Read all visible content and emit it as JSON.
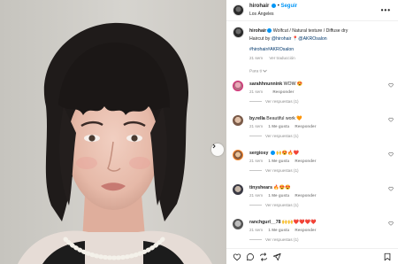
{
  "post": {
    "username": "hirohair",
    "separator": "•",
    "follow_label": "Seguir",
    "location": "Los Ángeles",
    "more_label": "•••"
  },
  "caption": {
    "username": "hirohair",
    "text_line1": " Wolfcut / Natural texture / Diffuse dry",
    "text_line2_prefix": "Haircut by ",
    "mention1": "@hirohair",
    "mention2": "@AKROsalon",
    "hashtags": "#hirohair#AKROsalon",
    "time": "21 sem",
    "translate_label": "Ver traducción"
  },
  "for_you_label": "Para ti",
  "comments": [
    {
      "username": "sarahhnunnink",
      "text": "WOW 😍",
      "time": "21 sem",
      "likes": "",
      "reply_label": "Responder",
      "replies_label": "Ver respuestas (1)"
    },
    {
      "username": "by.rella",
      "text": "Beautiful work 🧡",
      "time": "21 sem",
      "likes": "1 Me gusta",
      "reply_label": "Responder",
      "replies_label": "Ver respuestas (1)"
    },
    {
      "username": "sergiosy",
      "text": "🙌😍🔥❤️",
      "time": "21 sem",
      "likes": "1 Me gusta",
      "reply_label": "Responder",
      "replies_label": "Ver respuestas (1)"
    },
    {
      "username": "tinyshears",
      "text": "🔥😍😍",
      "time": "21 sem",
      "likes": "1 Me gusta",
      "reply_label": "Responder",
      "replies_label": "Ver respuestas (1)"
    },
    {
      "username": "ranchgurl__78",
      "text": "🙌🙌❤️❤️❤️❤️",
      "time": "21 sem",
      "likes": "1 Me gusta",
      "reply_label": "Responder",
      "replies_label": "Ver respuestas (1)"
    }
  ],
  "colors": {
    "accent": "#0095f6",
    "link": "#00376b",
    "muted": "#8e8e8e"
  }
}
